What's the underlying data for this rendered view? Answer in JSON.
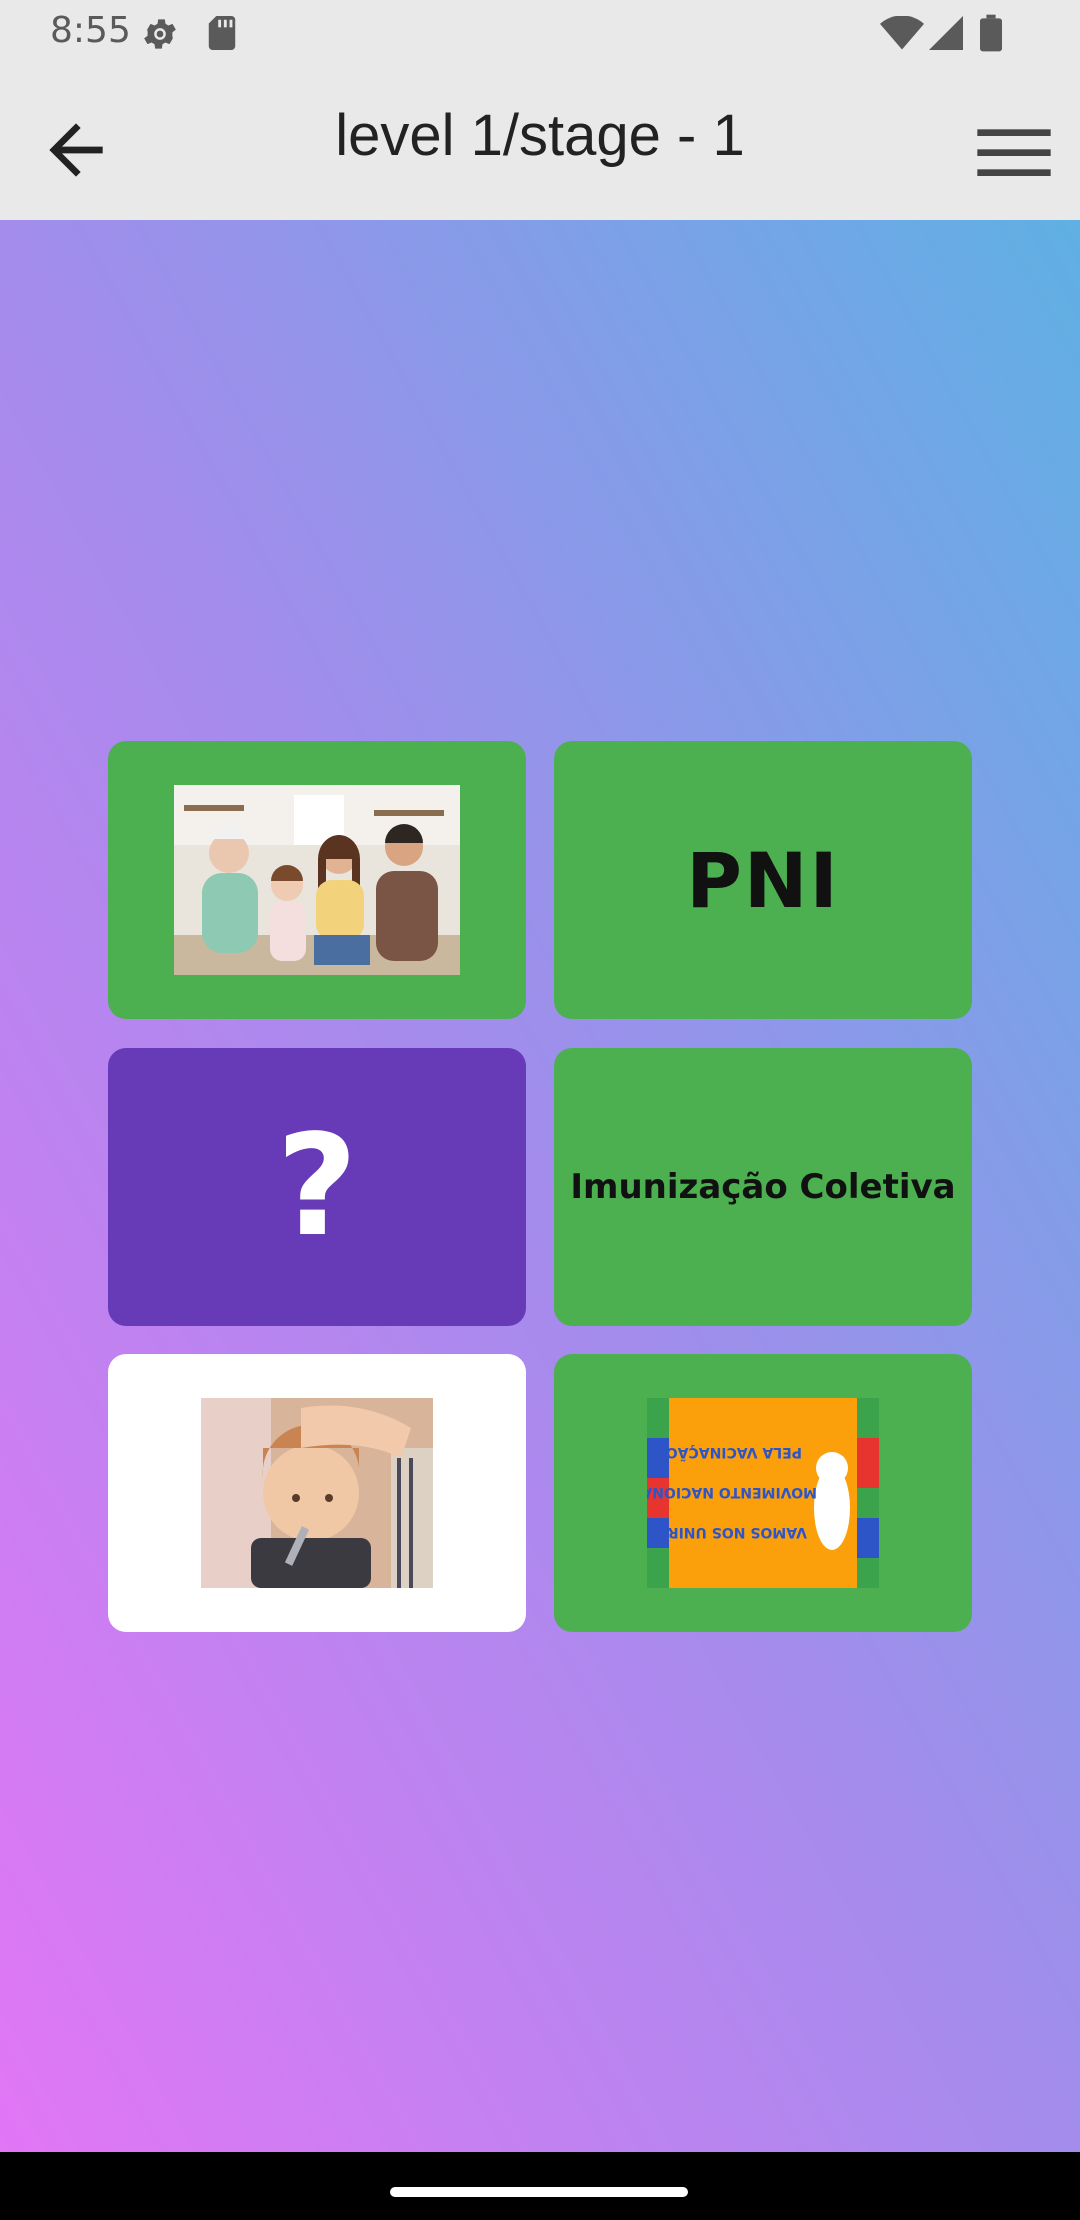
{
  "status_bar": {
    "time": "8:55",
    "icons": [
      "settings-gear-icon",
      "sd-card-icon",
      "wifi-icon",
      "cell-signal-icon",
      "battery-icon"
    ]
  },
  "app_bar": {
    "title": "level 1/stage - 1",
    "back_icon": "arrow-back-icon",
    "menu_icon": "hamburger-menu-icon"
  },
  "cards": [
    {
      "kind": "image",
      "image": "family-vaccinated-photo",
      "state": "revealed",
      "color": "#4caf50"
    },
    {
      "kind": "text",
      "text": "PNI",
      "state": "revealed",
      "color": "#4caf50"
    },
    {
      "kind": "hidden",
      "text": "?",
      "state": "hidden",
      "color": "#673ab7"
    },
    {
      "kind": "text",
      "text": "Imunização Coletiva",
      "state": "revealed",
      "color": "#4caf50"
    },
    {
      "kind": "image",
      "image": "sick-child-thermometer-photo",
      "state": "revealed",
      "color": "#ffffff"
    },
    {
      "kind": "image",
      "image": "vaccination-campaign-poster",
      "state": "revealed",
      "color": "#4caf50",
      "poster_text": [
        "VAMOS NOS UNIR AO",
        "MOVIMENTO NACIONAL",
        "PELA VACINAÇÃO"
      ]
    }
  ],
  "colors": {
    "card_green": "#4caf50",
    "card_purple": "#673ab7",
    "card_white": "#ffffff",
    "gradient_top": "#5fb0e4",
    "gradient_bottom": "#e276f5"
  }
}
